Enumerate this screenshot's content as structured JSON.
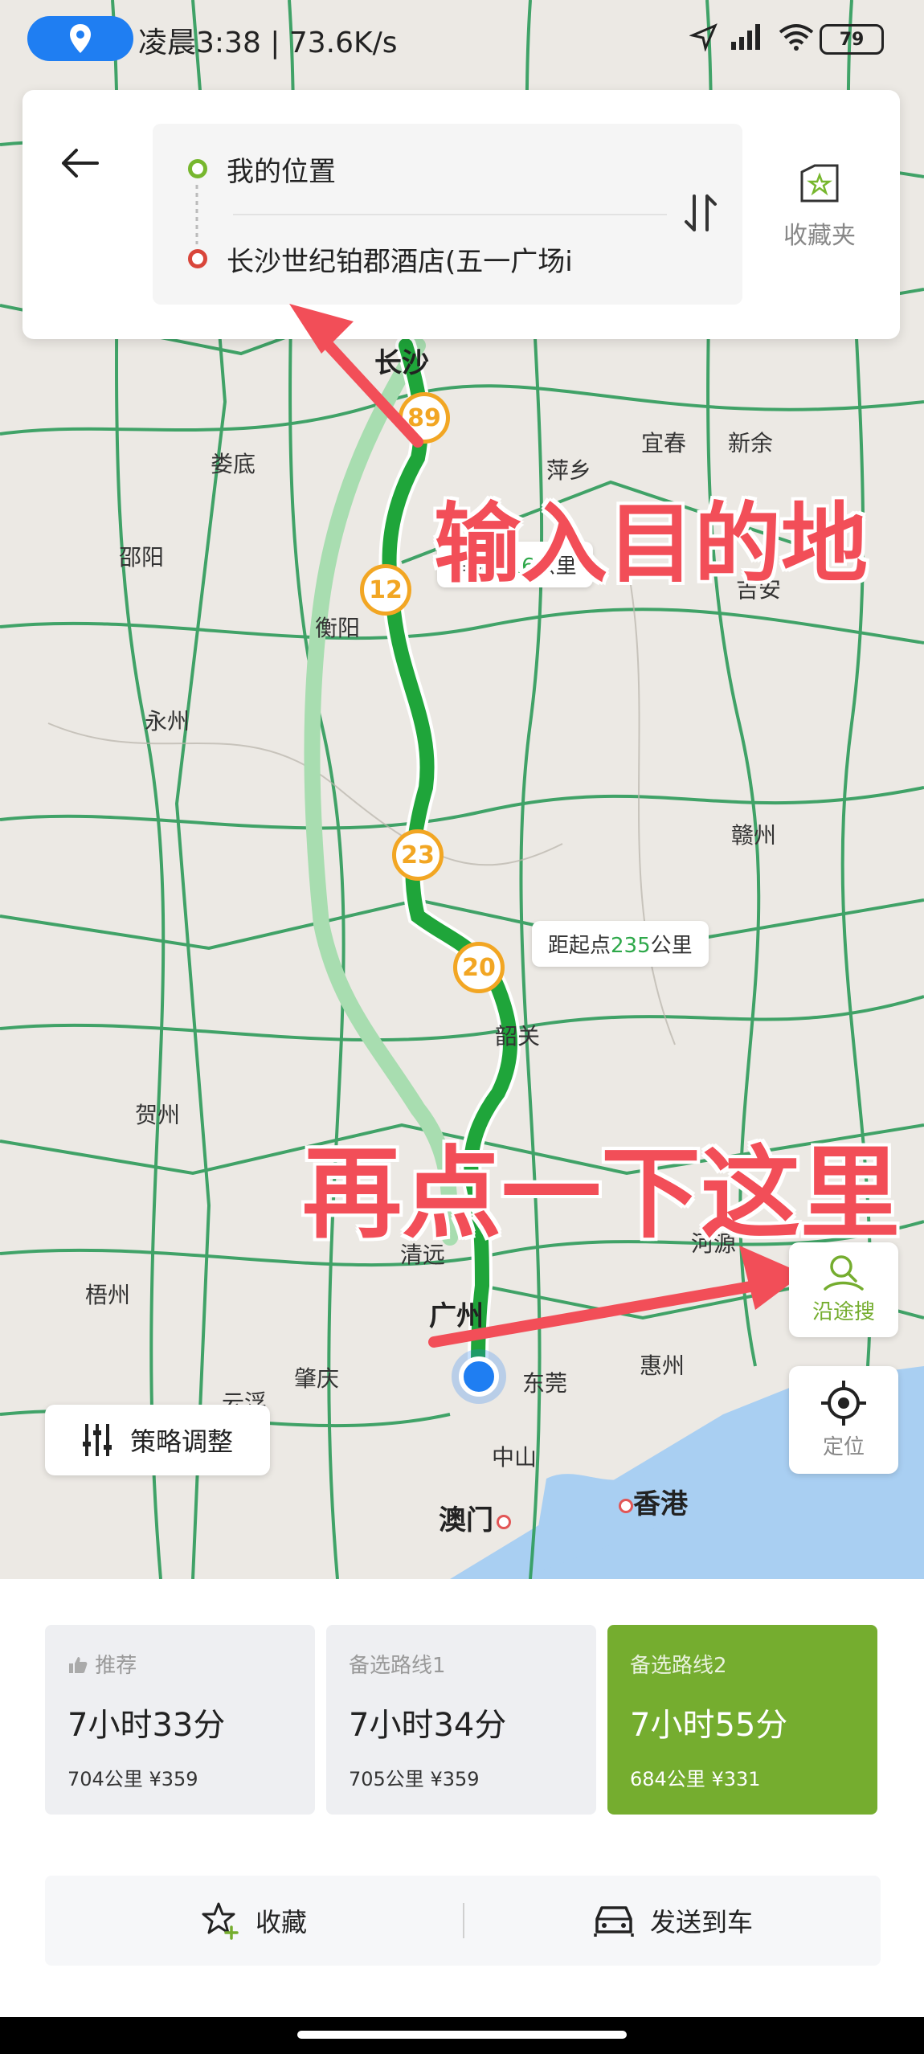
{
  "status_bar": {
    "text": "凌晨3:38 | 73.6K/s",
    "battery": "79"
  },
  "search": {
    "origin": "我的位置",
    "destination": "长沙世纪铂郡酒店(五一广场i",
    "favorites_label": "收藏夹"
  },
  "map": {
    "cities": {
      "changsha": "长沙",
      "loudi": "娄底",
      "shaoyang": "邵阳",
      "hengyang": "衡阳",
      "yongzhou": "永州",
      "pingxiang": "萍乡",
      "yichun": "宜春",
      "xinyu": "新余",
      "jian": "吉安",
      "ganzhou": "赣州",
      "shaoguan": "韶关",
      "hezhou": "贺州",
      "qingyuan": "清远",
      "heyuan": "河源",
      "guangzhou": "广州",
      "wuzhou": "梧州",
      "zhaoqing": "肇庆",
      "dongguan": "东莞",
      "huizhou": "惠州",
      "zhongshan": "中山",
      "macau": "澳门",
      "hongkong": "香港",
      "yunfu": "云浮"
    },
    "highway_markers": [
      "89",
      "12",
      "23",
      "20"
    ],
    "distance_bubbles": [
      {
        "prefix": "间隔",
        "num": "216",
        "suffix": "公里"
      },
      {
        "prefix": "距起点",
        "num": "235",
        "suffix": "公里"
      }
    ]
  },
  "annotations": {
    "enter_destination": "输入目的地",
    "tap_here_again": "再点一下这里"
  },
  "side_buttons": {
    "along_route_search": "沿途搜",
    "locate": "定位",
    "strategy": "策略调整"
  },
  "routes": [
    {
      "tag": "推荐",
      "time": "7小时33分",
      "distance": "704公里",
      "cost": "¥359",
      "active": false
    },
    {
      "tag": "备选路线1",
      "time": "7小时34分",
      "distance": "705公里",
      "cost": "¥359",
      "active": false
    },
    {
      "tag": "备选路线2",
      "time": "7小时55分",
      "distance": "684公里",
      "cost": "¥331",
      "active": true
    }
  ],
  "actions": {
    "favorite": "收藏",
    "send_to_car": "发送到车"
  },
  "colors": {
    "route_primary": "#1fa53a",
    "route_alt": "#a8ddb0",
    "active_card": "#75ad2f",
    "annotation": "#f24e58",
    "marker": "#f2a623",
    "location_blue": "#1f7ef2"
  }
}
